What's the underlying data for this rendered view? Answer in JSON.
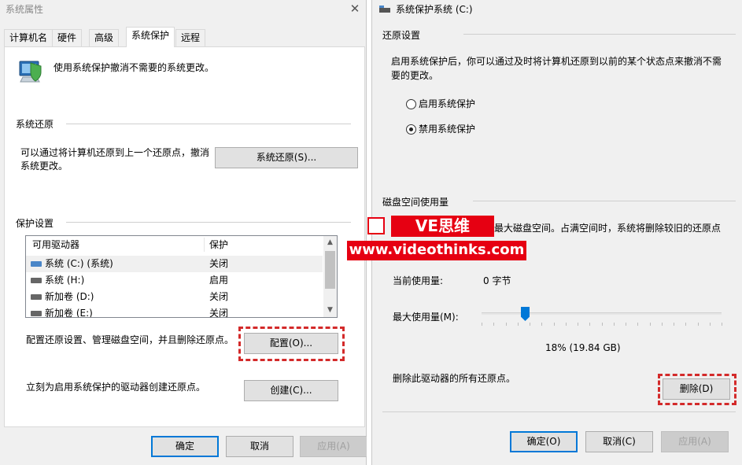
{
  "left_window": {
    "title": "系统属性",
    "tabs": [
      "计算机名",
      "硬件",
      "高级",
      "系统保护",
      "远程"
    ],
    "active_tab": "系统保护",
    "intro_text": "使用系统保护撤消不需要的系统更改。",
    "system_restore": {
      "section_label": "系统还原",
      "description_line1": "可以通过将计算机还原到上一个还原点，撤消",
      "description_line2": "系统更改。",
      "button_label": "系统还原(S)..."
    },
    "protection": {
      "section_label": "保护设置",
      "columns": [
        "可用驱动器",
        "保护"
      ],
      "rows": [
        {
          "drive": "系统 (C:) (系统)",
          "status": "关闭",
          "icon": "system-drive-icon"
        },
        {
          "drive": "系统 (H:)",
          "status": "启用",
          "icon": "drive-icon"
        },
        {
          "drive": "新加卷 (D:)",
          "status": "关闭",
          "icon": "drive-icon"
        },
        {
          "drive": "新加卷 (E:)",
          "status": "关闭",
          "icon": "drive-icon"
        }
      ],
      "configure_text": "配置还原设置、管理磁盘空间，并且删除还原点。",
      "configure_button": "配置(O)...",
      "create_text": "立刻为启用系统保护的驱动器创建还原点。",
      "create_button": "创建(C)..."
    },
    "footer": {
      "ok": "确定",
      "cancel": "取消",
      "apply": "应用(A)"
    }
  },
  "right_window": {
    "title": "系统保护系统 (C:)",
    "restore_settings": {
      "section_label": "还原设置",
      "description_line1": "启用系统保护后，你可以通过及时将计算机还原到以前的某个状态点来撤消不需",
      "description_line2": "要的更改。",
      "option_enable": "启用系统保护",
      "option_disable": "禁用系统保护",
      "selected": "禁用系统保护"
    },
    "disk_usage": {
      "section_label": "磁盘空间使用量",
      "description_visible": "最大磁盘空间。占满空间时，系统将删除较旧的还原点",
      "current_label": "当前使用量:",
      "current_value": "0 字节",
      "max_label": "最大使用量(M):",
      "slider_percent": 18,
      "slider_readout": "18% (19.84 GB)",
      "delete_text": "删除此驱动器的所有还原点。",
      "delete_button": "删除(D)"
    },
    "footer": {
      "ok": "确定(O)",
      "cancel": "取消(C)",
      "apply": "应用(A)"
    }
  },
  "watermark": {
    "line1": "VE思维",
    "line2": "www.videothinks.com"
  },
  "colors": {
    "highlight": "#d32a2a",
    "accent": "#0078d7",
    "watermark": "#e60012"
  }
}
